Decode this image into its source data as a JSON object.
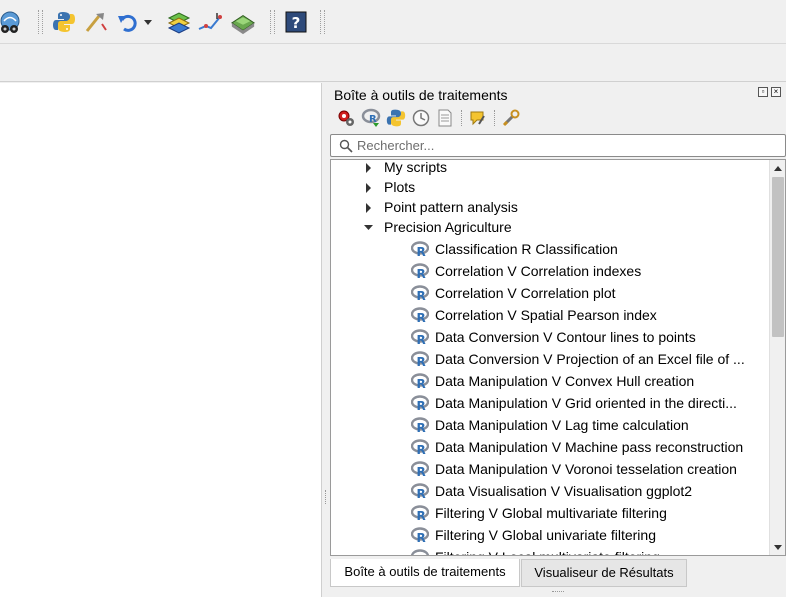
{
  "toolbar": {
    "icons": [
      "vehicle-icon",
      "python-icon",
      "digitize-icon",
      "undo-icon",
      "dropdown-arrow-icon",
      "layers-refresh-icon",
      "ruler-icon",
      "terrain-icon",
      "help-icon"
    ]
  },
  "panel": {
    "title": "Boîte à outils de traitements",
    "tool_icons": [
      "processing-gear-icon",
      "r-scripts-icon",
      "python-scripts-icon",
      "history-icon",
      "results-icon",
      "edit-script-icon",
      "options-icon"
    ]
  },
  "search": {
    "placeholder": "Rechercher..."
  },
  "tree": {
    "groups": [
      {
        "label": "My scripts",
        "expanded": false
      },
      {
        "label": "Plots",
        "expanded": false
      },
      {
        "label": "Point pattern analysis",
        "expanded": false
      },
      {
        "label": "Precision Agriculture",
        "expanded": true
      }
    ],
    "scripts": [
      "Classification R Classification",
      "Correlation V Correlation indexes",
      "Correlation V Correlation plot",
      "Correlation V Spatial Pearson index",
      "Data Conversion V Contour lines to points",
      "Data Conversion V Projection of an Excel file of ...",
      "Data Manipulation V Convex Hull creation",
      "Data Manipulation V Grid oriented in the directi...",
      "Data Manipulation V Lag time calculation",
      "Data Manipulation V Machine pass reconstruction",
      "Data Manipulation V Voronoi tesselation creation",
      "Data Visualisation V Visualisation ggplot2",
      "Filtering V Global multivariate filtering",
      "Filtering V Global univariate filtering",
      "Filtering V Local multivariate filtering"
    ]
  },
  "tabs": [
    {
      "label": "Boîte à outils de traitements",
      "active": true
    },
    {
      "label": "Visualiseur de Résultats",
      "active": false
    }
  ],
  "colors": {
    "r_blue": "#2f6fb5",
    "r_gray": "#8a8f99",
    "accent": "#1e5aa8"
  }
}
